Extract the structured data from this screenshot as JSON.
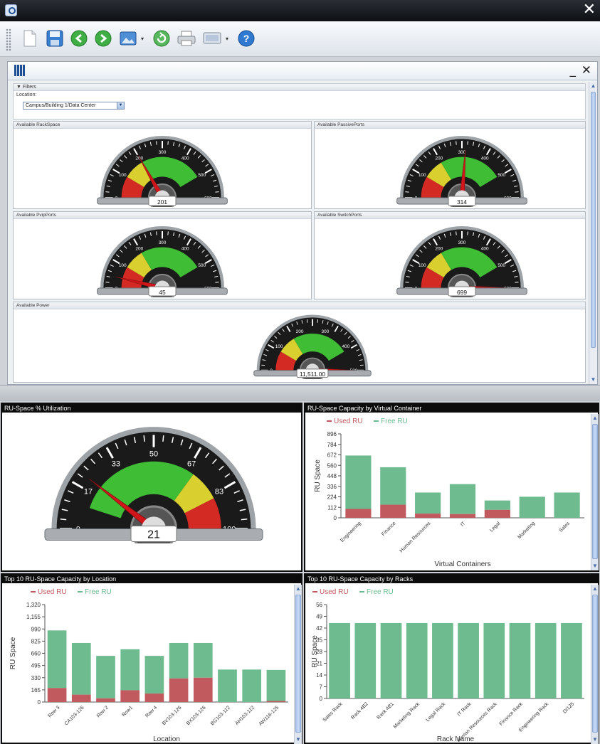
{
  "window": {
    "title_icon": "app-logo-icon",
    "close_glyph": "✕"
  },
  "toolbar": {
    "items": [
      {
        "name": "new-document-icon"
      },
      {
        "name": "save-icon"
      },
      {
        "name": "back-icon"
      },
      {
        "name": "forward-icon"
      },
      {
        "name": "image-export-icon",
        "dropdown": true
      },
      {
        "name": "refresh-icon"
      },
      {
        "name": "print-icon"
      },
      {
        "name": "display-icon",
        "dropdown": true
      },
      {
        "name": "help-icon"
      }
    ]
  },
  "inner_window": {
    "minimize_glyph": "_",
    "close_glyph": "✕"
  },
  "filters": {
    "header": "▼ Filters",
    "location_label": "Location:",
    "location_value": "Campus/Building 1/Data Center"
  },
  "small_gauges": [
    {
      "title": "Available RackSpace",
      "value": 201,
      "display": "201",
      "ticks": [
        "0",
        "100",
        "200",
        "300",
        "400",
        "500",
        "600"
      ],
      "max": 600
    },
    {
      "title": "Available PassivePorts",
      "value": 314,
      "display": "314",
      "ticks": [
        "0",
        "100",
        "200",
        "300",
        "400",
        "500",
        "600"
      ],
      "max": 600
    },
    {
      "title": "Available PvipPorts",
      "value": 45,
      "display": "45",
      "ticks": [
        "0",
        "100",
        "200",
        "300",
        "400",
        "500",
        "600"
      ],
      "max": 600
    },
    {
      "title": "Available SwitchPorts",
      "value": 699,
      "display": "699",
      "ticks": [
        "0",
        "100",
        "200",
        "300",
        "400",
        "500",
        "600"
      ],
      "max": 600
    },
    {
      "title": "Available Power",
      "value": 11511,
      "display": "11,511.00",
      "ticks": [
        "0",
        "100",
        "200",
        "300",
        "400",
        "500"
      ],
      "max": 500
    }
  ],
  "utilization": {
    "title": "RU-Space % Utilization",
    "value": 21,
    "display": "21",
    "ticks": [
      "0",
      "17",
      "33",
      "50",
      "67",
      "83",
      "100"
    ],
    "max": 100
  },
  "charts": [
    {
      "title": "RU-Space Capacity by Virtual Container",
      "legend": [
        "Used RU",
        "Free RU"
      ],
      "chart_data": {
        "type": "bar",
        "stacked": true,
        "categories": [
          "Engineering",
          "Finance",
          "Human Resources",
          "IT",
          "Legal",
          "Marketing",
          "Sales"
        ],
        "series": [
          {
            "name": "Used RU",
            "values": [
              95,
              140,
              45,
              40,
              85,
              0,
              0
            ]
          },
          {
            "name": "Free RU",
            "values": [
              570,
              400,
              225,
              320,
              100,
              225,
              270
            ]
          }
        ],
        "ylabel": "RU Space",
        "xlabel": "Virtual Containers",
        "yticks": [
          "0",
          "112",
          "224",
          "336",
          "448",
          "560",
          "672",
          "784",
          "896"
        ],
        "ylim": [
          0,
          896
        ]
      }
    },
    {
      "title": "Top 10 RU-Space Capacity by Location",
      "legend": [
        "Used RU",
        "Free RU"
      ],
      "chart_data": {
        "type": "bar",
        "stacked": true,
        "categories": [
          "Row 3",
          "CA103-126",
          "Row 2",
          "Row1",
          "Row 4",
          "BV103-126",
          "BX103-126",
          "BG103-112",
          "AH103-112",
          "AW116-125"
        ],
        "series": [
          {
            "name": "Used RU",
            "values": [
              190,
              100,
              50,
              160,
              115,
              320,
              330,
              0,
              0,
              15
            ]
          },
          {
            "name": "Free RU",
            "values": [
              780,
              700,
              575,
              555,
              510,
              480,
              470,
              440,
              440,
              420
            ]
          }
        ],
        "ylabel": "RU Space",
        "xlabel": "Location",
        "yticks": [
          "0",
          "165",
          "330",
          "495",
          "660",
          "825",
          "990",
          "1,155",
          "1,320"
        ],
        "ylim": [
          0,
          1320
        ]
      }
    },
    {
      "title": "Top 10 RU-Space Capacity by Racks",
      "legend": [
        "Used RU",
        "Free RU"
      ],
      "chart_data": {
        "type": "bar",
        "stacked": true,
        "categories": [
          "Sales Rack",
          "Rack 4B2",
          "Rack 4B1",
          "Marketing Rack",
          "Legal Rack",
          "IT Rack",
          "Human Resources Rack",
          "Finance Rack",
          "Engineering Rack",
          "DI125"
        ],
        "series": [
          {
            "name": "Used RU",
            "values": [
              0,
              0,
              0,
              0,
              0,
              0,
              0,
              0,
              0,
              0
            ]
          },
          {
            "name": "Free RU",
            "values": [
              45,
              45,
              45,
              45,
              45,
              45,
              45,
              45,
              45,
              45
            ]
          }
        ],
        "ylabel": "RU Space",
        "xlabel": "Rack Name",
        "yticks": [
          "0",
          "7",
          "14",
          "21",
          "28",
          "35",
          "42",
          "49",
          "56"
        ],
        "ylim": [
          0,
          56
        ]
      }
    }
  ],
  "colors": {
    "used": "#c05a5e",
    "free": "#6dbb8f",
    "gauge_red": "#d42a24",
    "gauge_yellow": "#d9cf2e",
    "gauge_green": "#3fbd34",
    "needle": "#d1161b"
  }
}
